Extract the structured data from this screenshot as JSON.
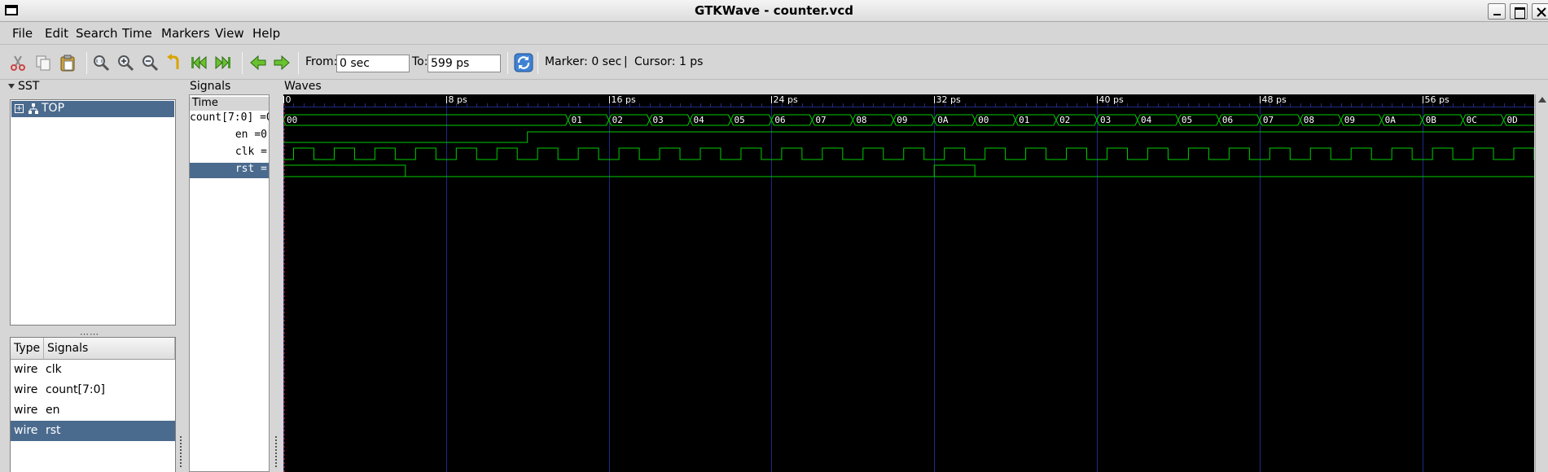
{
  "window": {
    "title": "GTKWave - counter.vcd"
  },
  "menu": [
    "File",
    "Edit",
    "Search",
    "Time",
    "Markers",
    "View",
    "Help"
  ],
  "toolbar": {
    "from_label": "From:",
    "from_value": "0 sec",
    "to_label": "To:",
    "to_value": "599 ps",
    "marker_label": "Marker: 0 sec",
    "separator": "|",
    "cursor_label": "Cursor: 1 ps"
  },
  "sst": {
    "title": "SST",
    "tree_root": "TOP",
    "expander": "+",
    "columns": {
      "type": "Type",
      "signals": "Signals"
    },
    "signals": [
      {
        "type": "wire",
        "name": "clk",
        "selected": false
      },
      {
        "type": "wire",
        "name": "count[7:0]",
        "selected": false
      },
      {
        "type": "wire",
        "name": "en",
        "selected": false
      },
      {
        "type": "wire",
        "name": "rst",
        "selected": true
      }
    ]
  },
  "signals_pane": {
    "title": "Signals",
    "time_header": "Time",
    "rows": [
      {
        "label": "count[7:0] =0",
        "selected": false
      },
      {
        "label": "en =0",
        "selected": false
      },
      {
        "label": "clk =",
        "selected": false
      },
      {
        "label": "rst =",
        "selected": true
      }
    ]
  },
  "waves": {
    "title": "Waves",
    "time_unit": "ps",
    "timeline": {
      "visible_start": 0,
      "visible_end": 61.5,
      "major_tick_step": 8,
      "minor_tick_step": 0.5,
      "major_labels": [
        "0",
        "8 ps",
        "16 ps",
        "24 ps",
        "32 ps",
        "40 ps",
        "48 ps",
        "56 ps"
      ]
    },
    "colors": {
      "background": "#000000",
      "wave": "#00cc00",
      "grid": "#1f2a86",
      "text": "#ffffff",
      "marker": "#ff3030"
    },
    "clk": {
      "period_ps": 2,
      "first_rise_ps": 0.5
    },
    "en": [
      {
        "t": 0,
        "v": 0
      },
      {
        "t": 12,
        "v": 1
      }
    ],
    "rst": [
      {
        "t": 0,
        "v": 1
      },
      {
        "t": 6,
        "v": 0
      },
      {
        "t": 32,
        "v": 1
      },
      {
        "t": 34,
        "v": 0
      }
    ],
    "count": [
      {
        "t": 0,
        "v": "00"
      },
      {
        "t": 14,
        "v": "01"
      },
      {
        "t": 16,
        "v": "02"
      },
      {
        "t": 18,
        "v": "03"
      },
      {
        "t": 20,
        "v": "04"
      },
      {
        "t": 22,
        "v": "05"
      },
      {
        "t": 24,
        "v": "06"
      },
      {
        "t": 26,
        "v": "07"
      },
      {
        "t": 28,
        "v": "08"
      },
      {
        "t": 30,
        "v": "09"
      },
      {
        "t": 32,
        "v": "0A"
      },
      {
        "t": 34,
        "v": "00"
      },
      {
        "t": 36,
        "v": "01"
      },
      {
        "t": 38,
        "v": "02"
      },
      {
        "t": 40,
        "v": "03"
      },
      {
        "t": 42,
        "v": "04"
      },
      {
        "t": 44,
        "v": "05"
      },
      {
        "t": 46,
        "v": "06"
      },
      {
        "t": 48,
        "v": "07"
      },
      {
        "t": 50,
        "v": "08"
      },
      {
        "t": 52,
        "v": "09"
      },
      {
        "t": 54,
        "v": "0A"
      },
      {
        "t": 56,
        "v": "0B"
      },
      {
        "t": 58,
        "v": "0C"
      },
      {
        "t": 60,
        "v": "0D"
      }
    ]
  }
}
